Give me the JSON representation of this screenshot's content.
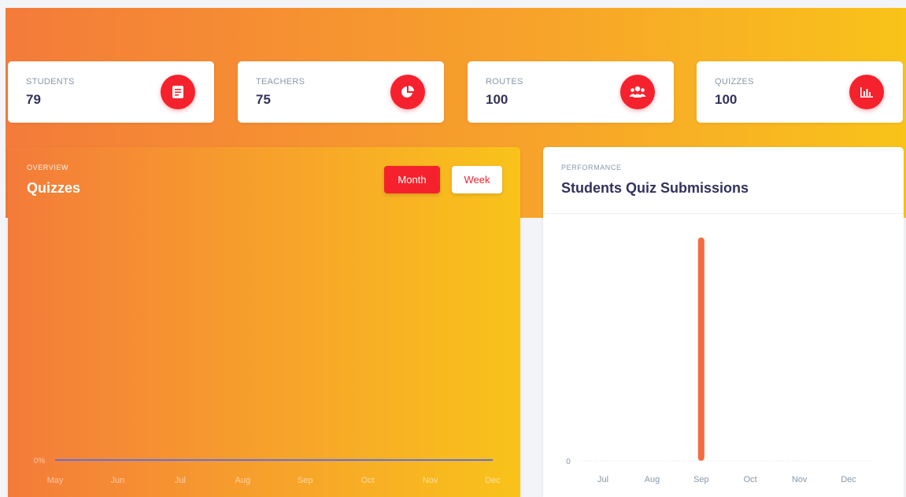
{
  "stats": [
    {
      "label": "STUDENTS",
      "value": "79",
      "icon": "book-icon"
    },
    {
      "label": "TEACHERS",
      "value": "75",
      "icon": "pie-chart-icon"
    },
    {
      "label": "ROUTES",
      "value": "100",
      "icon": "users-icon"
    },
    {
      "label": "QUIZZES",
      "value": "100",
      "icon": "bar-chart-icon"
    }
  ],
  "overview": {
    "eyebrow": "OVERVIEW",
    "title": "Quizzes",
    "month_label": "Month",
    "week_label": "Week"
  },
  "performance": {
    "eyebrow": "PERFORMANCE",
    "title": "Students Quiz Submissions"
  },
  "colors": {
    "accent": "#f5222d",
    "gradient_start": "#f47b3a",
    "gradient_end": "#f9c31a",
    "bar": "#f46b3f",
    "line": "#5e72e4"
  },
  "chart_data": [
    {
      "type": "line",
      "categories": [
        "May",
        "Jun",
        "Jul",
        "Aug",
        "Sep",
        "Oct",
        "Nov",
        "Dec"
      ],
      "series": [
        {
          "values": [
            0,
            0,
            0,
            0,
            0,
            0,
            0,
            0
          ]
        }
      ],
      "ytick_labels": [
        "0%"
      ],
      "grid": false
    },
    {
      "type": "bar",
      "categories": [
        "Jul",
        "Aug",
        "Sep",
        "Oct",
        "Nov",
        "Dec"
      ],
      "values": [
        0,
        0,
        1,
        0,
        0,
        0
      ],
      "ytick_labels": [
        "0"
      ],
      "grid": true
    }
  ]
}
